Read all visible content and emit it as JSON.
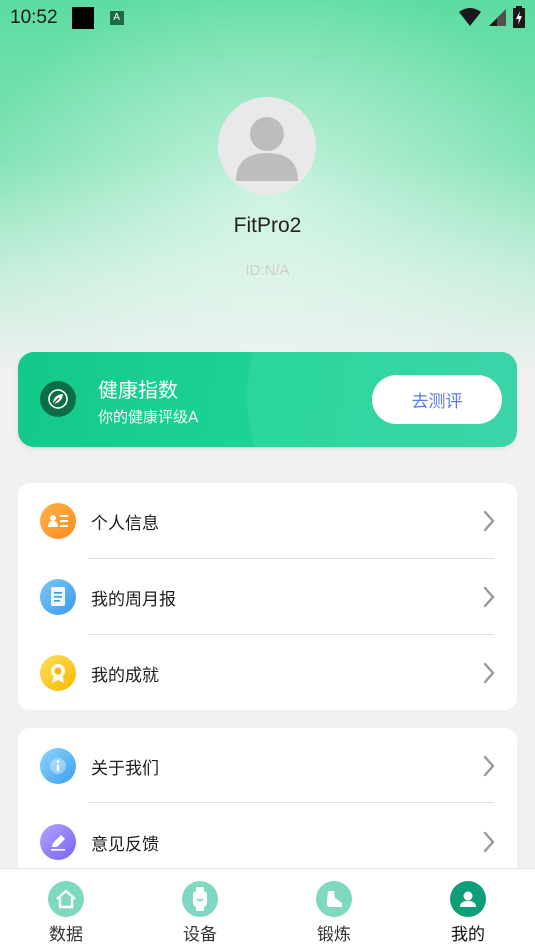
{
  "status_bar": {
    "time": "10:52",
    "notification_letter": "A"
  },
  "profile": {
    "username": "FitPro2",
    "user_id": "ID:N/A"
  },
  "health_card": {
    "title": "健康指数",
    "subtitle": "你的健康评级A",
    "button_label": "去测评"
  },
  "menu_group_1": {
    "items": [
      {
        "label": "个人信息",
        "icon": "person-card-icon"
      },
      {
        "label": "我的周月报",
        "icon": "report-icon"
      },
      {
        "label": "我的成就",
        "icon": "medal-icon"
      }
    ]
  },
  "menu_group_2": {
    "items": [
      {
        "label": "关于我们",
        "icon": "info-icon"
      },
      {
        "label": "意见反馈",
        "icon": "feedback-icon"
      }
    ]
  },
  "tab_bar": {
    "tabs": [
      {
        "label": "数据",
        "icon": "home-icon"
      },
      {
        "label": "设备",
        "icon": "watch-icon"
      },
      {
        "label": "锻炼",
        "icon": "shoe-icon"
      },
      {
        "label": "我的",
        "icon": "person-icon",
        "selected": true
      }
    ]
  },
  "colors": {
    "accent": "#1ed496",
    "button_text": "#5a7ce0",
    "tab_inactive": "#7fd8c0",
    "tab_active": "#0f9e77"
  }
}
